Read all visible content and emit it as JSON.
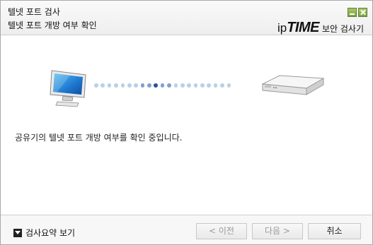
{
  "header": {
    "title_line1": "텔넷 포트 검사",
    "title_line2": "텔넷 포트 개방 여부 확인",
    "brand_ip": "ip",
    "brand_time": "TIME",
    "brand_sub": "보안 검사기"
  },
  "window_controls": {
    "minimize_icon": "minimize-icon",
    "close_icon": "close-icon"
  },
  "main": {
    "status_message": "공유기의 텔넷 포트 개방 여부를 확인 중입니다.",
    "progress_dot_count": 21,
    "progress_highlight_index": 9
  },
  "footer": {
    "summary_label": "검사요약 보기",
    "prev_label": "< 이전",
    "next_label": "다음 >",
    "cancel_label": "취소"
  },
  "colors": {
    "brand_accent": "#8fb04a",
    "dot_inactive": "#b9d0e8",
    "dot_active": "#2b4fa8"
  }
}
